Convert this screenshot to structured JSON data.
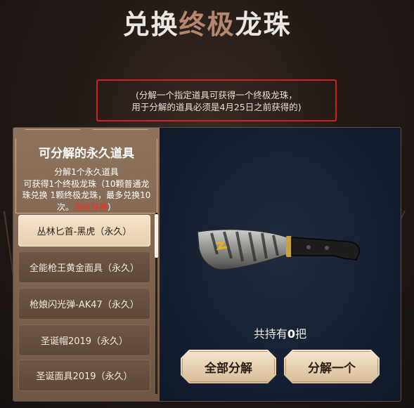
{
  "title": {
    "part1": "兑换",
    "part2": "终极",
    "part3": "龙珠"
  },
  "notice": {
    "line1": "(分解一个指定道具可获得一个终极龙珠，",
    "line2": "用于分解的道具必须是4月25日之前获得的)"
  },
  "left_panel": {
    "title": "可分解的永久道具",
    "desc_line1": "分解1个永久道具",
    "desc_line2": "可获得1个终极龙珠（10颗普通龙",
    "desc_line3": "珠兑换 1颗终极龙珠，最多兑换10",
    "desc_line4_pre": "次。",
    "desc_link": "点击兑换",
    "desc_line4_post": "）",
    "items": [
      {
        "label": "丛林匕首-黑虎（永久）",
        "selected": true
      },
      {
        "label": "全能枪王黄金面具（永久）",
        "selected": false
      },
      {
        "label": "枪娘闪光弹-AK47（永久）",
        "selected": false
      },
      {
        "label": "圣诞帽2019（永久）",
        "selected": false
      },
      {
        "label": "圣诞面具2019（永久）",
        "selected": false
      }
    ]
  },
  "right_panel": {
    "hold_pre": "共持有",
    "hold_count": "0",
    "hold_post": "把",
    "btn_all": "全部分解",
    "btn_one": "分解一个"
  },
  "colors": {
    "accent_red": "#d21f24",
    "link_red": "#ff2a1e",
    "title_bronze": "#b5876d",
    "button_gold": "#e6cdb0"
  }
}
